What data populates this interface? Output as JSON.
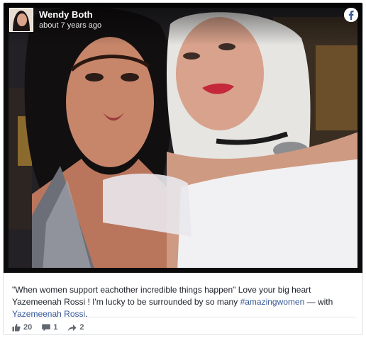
{
  "post": {
    "author": "Wendy Both",
    "timestamp": "about 7 years ago",
    "caption": {
      "text_1": "\"When women support eachother incredible things happen\" Love your big heart Yazemeenah Rossi ! I'm lucky to be surrounded by so many ",
      "hashtag": "#amazingwomen",
      "text_2": " — with ",
      "tagged": "Yazemeenah Rossi",
      "text_3": "."
    },
    "stats": {
      "likes": "20",
      "comments": "1",
      "shares": "2"
    }
  },
  "icons": {
    "brand": "facebook-logo-icon",
    "like": "thumbs-up-icon",
    "comment": "comment-bubble-icon",
    "share": "share-arrow-icon"
  },
  "colors": {
    "link": "#365899",
    "text": "#1d2129",
    "stat_text": "#606770",
    "border": "#dddfe2"
  }
}
